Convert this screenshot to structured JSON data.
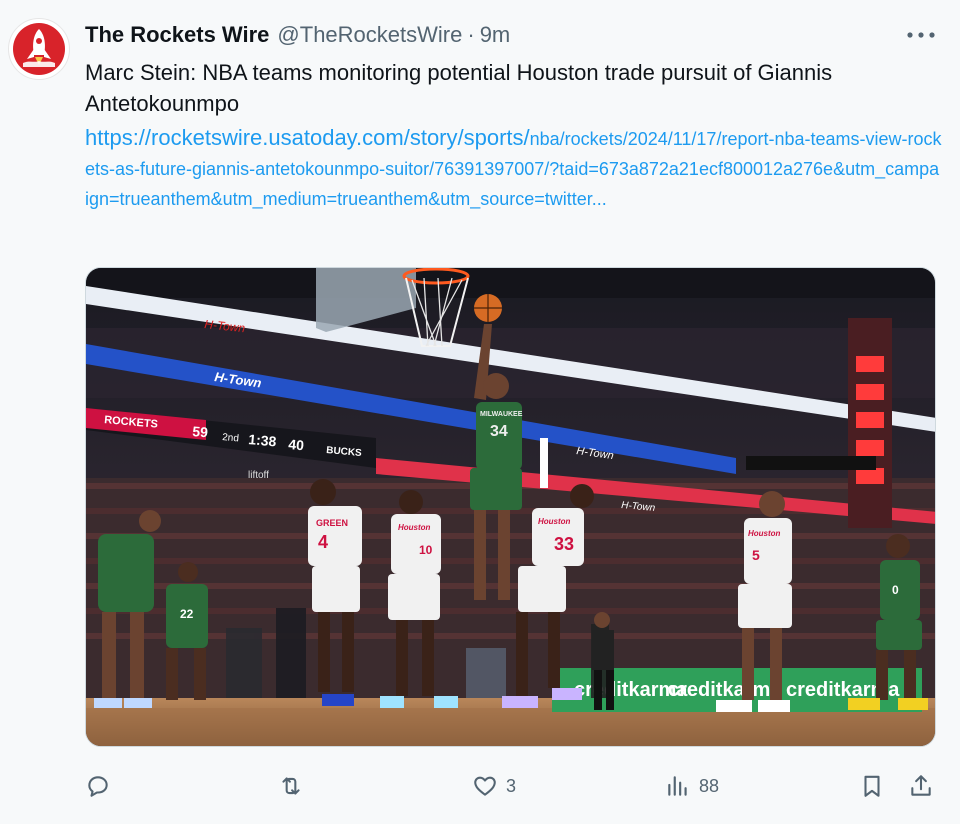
{
  "tweet": {
    "display_name": "The Rockets Wire",
    "handle": "@TheRocketsWire",
    "separator": "·",
    "time": "9m",
    "text": "Marc Stein: NBA teams monitoring potential Houston trade pursuit of Giannis Antetokounmpo",
    "link_prefix": "https://rocketswire.usatoday.com/story/sports/",
    "link_rest": "nba/rockets/2024/11/17/report-nba-teams-view-rockets-as-future-giannis-antetokounmpo-suitor/76391397007/?taid=673a872a21ecf800012a276e&utm_campaign=trueanthem&utm_medium=trueanthem&utm_source=twitter...",
    "more_icon": "ellipsis-icon",
    "avatar_icon": "rocket-logo"
  },
  "media": {
    "scoreboard": {
      "home": "ROCKETS",
      "home_score": "59",
      "period": "2nd",
      "clock": "1:38",
      "shot_clock": "40",
      "away": "BUCKS"
    },
    "jerseys": [
      "4",
      "10",
      "34",
      "33",
      "5",
      "22",
      "0"
    ],
    "jersey_names": [
      "GREEN",
      "Houston",
      "MILWAUKEE",
      "Houston",
      "Houston"
    ],
    "court_ads": [
      "creditkarma",
      "creditkarma",
      "creditkarma"
    ],
    "banner_text": [
      "H-Town",
      "H-Town",
      "H-Town",
      "H-Town",
      "liftoff"
    ]
  },
  "actions": {
    "reply": {
      "icon": "reply-icon",
      "count": ""
    },
    "retweet": {
      "icon": "retweet-icon",
      "count": ""
    },
    "like": {
      "icon": "heart-icon",
      "count": "3"
    },
    "views": {
      "icon": "views-icon",
      "count": "88"
    },
    "bookmark": {
      "icon": "bookmark-icon"
    },
    "share": {
      "icon": "share-icon"
    }
  },
  "colors": {
    "link": "#1d9bf0",
    "secondary_text": "#536471",
    "rockets_red": "#ce1141",
    "bucks_green": "#00471b"
  }
}
